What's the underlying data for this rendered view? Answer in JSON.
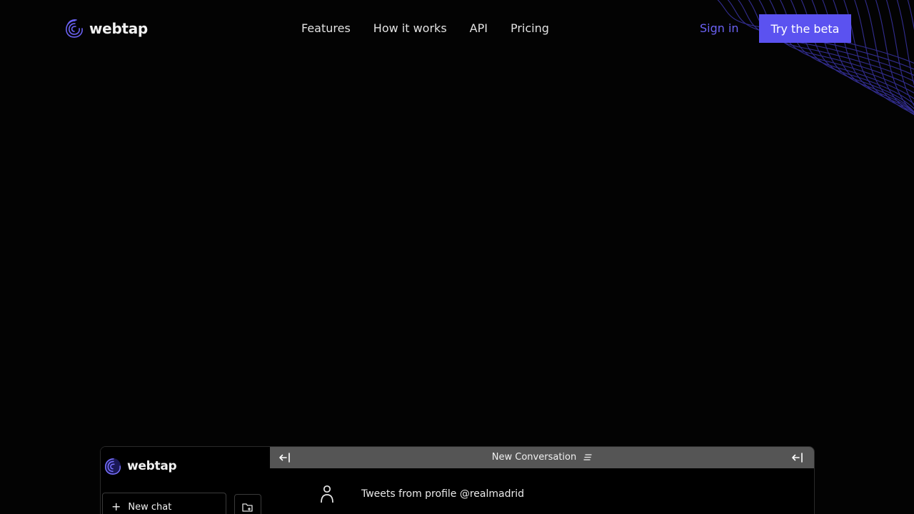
{
  "header": {
    "brand_name": "webtap",
    "nav": [
      {
        "label": "Features"
      },
      {
        "label": "How it works"
      },
      {
        "label": "API"
      },
      {
        "label": "Pricing"
      }
    ],
    "signin_label": "Sign in",
    "cta_label": "Try the beta"
  },
  "colors": {
    "accent": "#5b52f0",
    "link": "#6b62f4",
    "background": "#030303",
    "wave_line": "#3b35a8"
  },
  "preview": {
    "brand_name": "webtap",
    "new_chat_label": "New chat",
    "conversation_title": "New Conversation",
    "message_text": "Tweets from profile @realmadrid",
    "icons": {
      "brand": "swirl-logo-icon",
      "new_chat": "plus-icon",
      "folder": "folder-plus-icon",
      "collapse": "collapse-left-icon",
      "menu": "menu-lines-icon",
      "user": "user-icon"
    }
  }
}
